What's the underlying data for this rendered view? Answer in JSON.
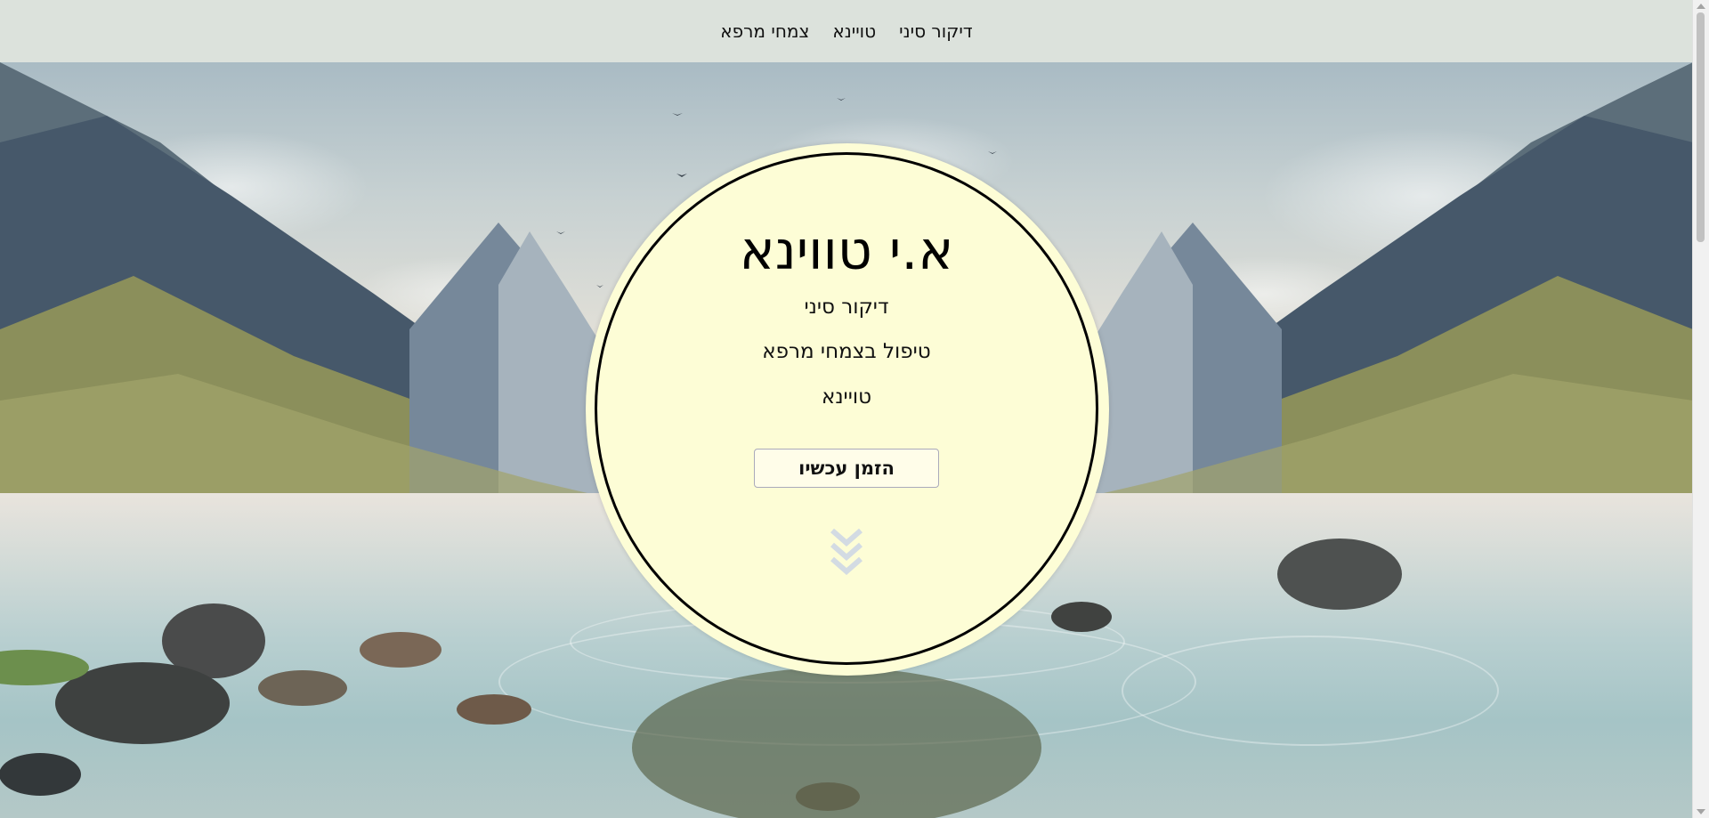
{
  "nav": {
    "items": [
      {
        "label": "דיקור סיני"
      },
      {
        "label": "טויינא"
      },
      {
        "label": "צמחי מרפא"
      }
    ]
  },
  "hero": {
    "title": "א.י טווינא",
    "lines": [
      "דיקור סיני",
      "טיפול בצמחי מרפא",
      "טויינא"
    ],
    "cta_label": "הזמן עכשיו",
    "scroll_icon": "chevrons-down-icon",
    "background_image": "mountain-lake-landscape"
  },
  "colors": {
    "nav_bg": "#dce2dc",
    "circle_bg": "#fdfdd6",
    "circle_border": "#000000",
    "chevron": "#d3dbe3"
  }
}
